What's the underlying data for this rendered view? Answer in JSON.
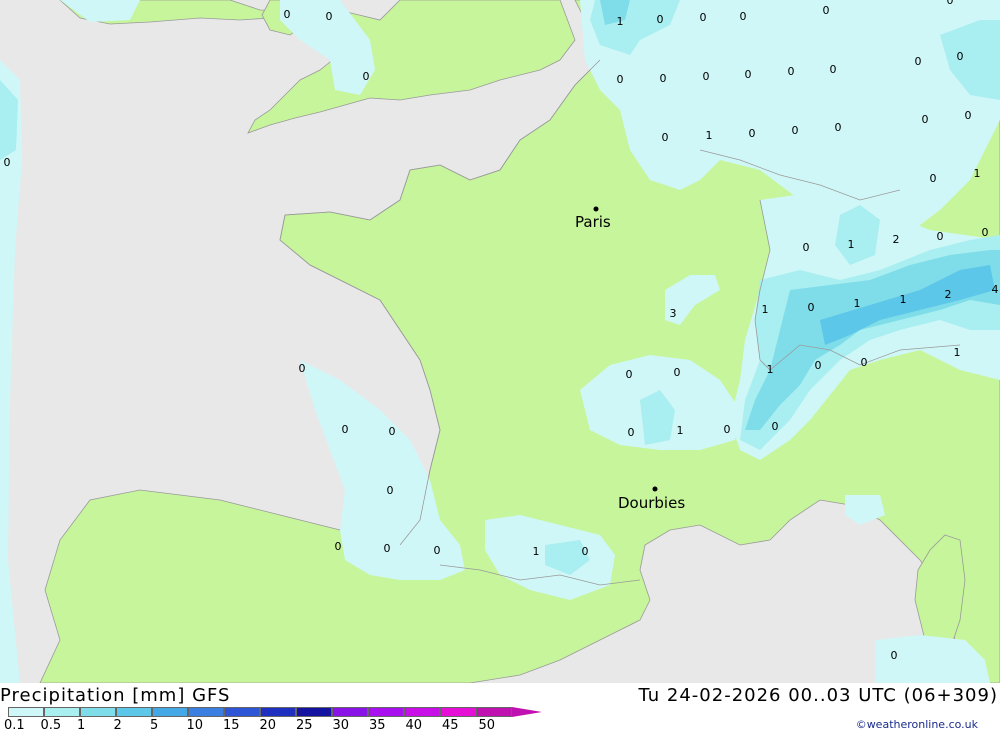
{
  "map": {
    "cities": [
      {
        "name": "Paris",
        "id": "paris"
      },
      {
        "name": "Dourbies",
        "id": "dourbies"
      }
    ],
    "grid_values": [
      "0",
      "0",
      "1",
      "0",
      "0",
      "0",
      "0",
      "0",
      "0",
      "0",
      "0",
      "0",
      "0",
      "0",
      "0",
      "0",
      "0",
      "0",
      "0",
      "1",
      "0",
      "0",
      "0",
      "0",
      "0",
      "0",
      "1",
      "0",
      "1",
      "2",
      "0",
      "0",
      "1",
      "0",
      "1",
      "1",
      "2",
      "4",
      "3",
      "1",
      "0",
      "0",
      "0",
      "1",
      "0",
      "0",
      "0",
      "0",
      "0",
      "1",
      "0",
      "0",
      "0",
      "0",
      "0",
      "0",
      "1",
      "0",
      "0"
    ],
    "colors": {
      "sea": "#e8e8e8",
      "land": "#c6f59b",
      "precip_0_1": "#d0f7f7",
      "precip_0_5": "#a9eef0",
      "precip_1": "#7fdde9",
      "precip_2": "#5cc7e8",
      "border": "#9a9a9a"
    }
  },
  "footer": {
    "title": "Precipitation [mm] GFS",
    "timestamp": "Tu 24-02-2026 00..03 UTC (06+309)",
    "credit": "©weatheronline.co.uk",
    "legend": [
      {
        "label": "0.1",
        "color": "#d0f7f7"
      },
      {
        "label": "0.5",
        "color": "#a9eef0"
      },
      {
        "label": "1",
        "color": "#7fdde9"
      },
      {
        "label": "2",
        "color": "#5cc7e8"
      },
      {
        "label": "5",
        "color": "#45a8e6"
      },
      {
        "label": "10",
        "color": "#3b7fe0"
      },
      {
        "label": "15",
        "color": "#2e55d6"
      },
      {
        "label": "20",
        "color": "#1f2fbf"
      },
      {
        "label": "25",
        "color": "#1414a0"
      },
      {
        "label": "30",
        "color": "#8a14e8"
      },
      {
        "label": "35",
        "color": "#a810f0"
      },
      {
        "label": "40",
        "color": "#c80fe8"
      },
      {
        "label": "45",
        "color": "#e60fd8"
      },
      {
        "label": "50",
        "color": "#c012b0"
      }
    ]
  }
}
